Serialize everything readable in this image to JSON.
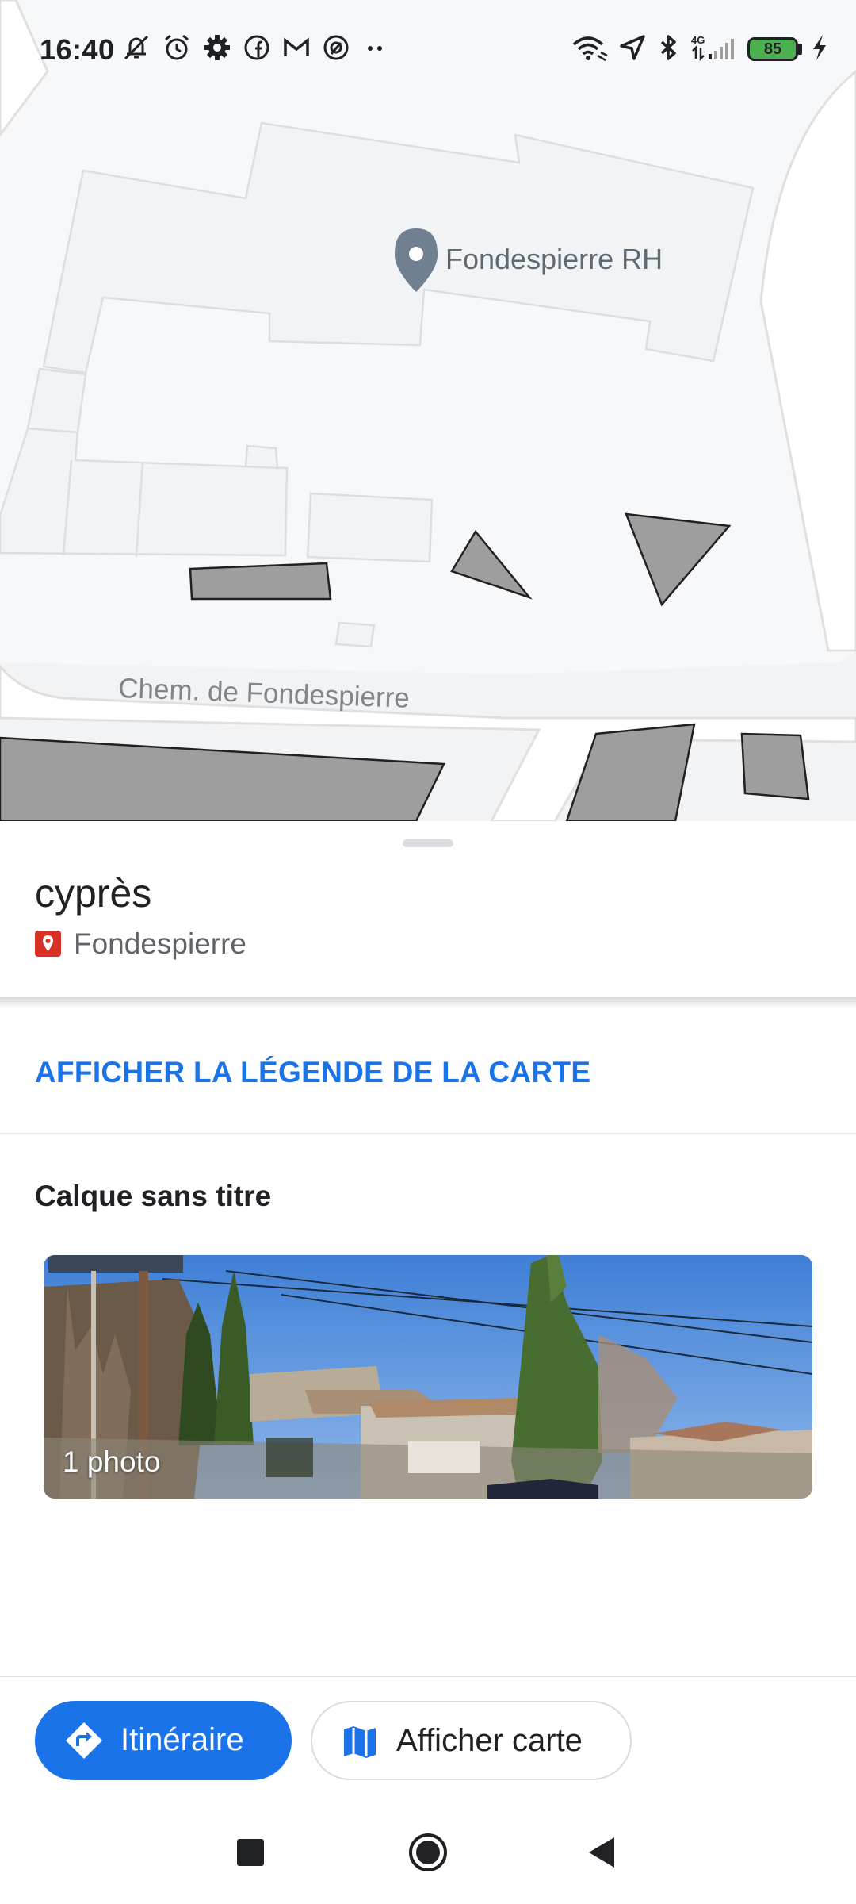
{
  "status_bar": {
    "time": "16:40",
    "battery_level": "85",
    "network": "4G",
    "left_icons": [
      "bell-off-icon",
      "alarm-icon",
      "gear-icon",
      "facebook-icon",
      "gmail-icon",
      "app-notification-icon",
      "more-dots-icon"
    ],
    "right_icons": [
      "wifi-icon",
      "location-arrow-icon",
      "bluetooth-icon",
      "signal-icon",
      "battery-icon",
      "charging-icon"
    ]
  },
  "map": {
    "place_label": "Fondespierre RH",
    "road_label": "Chem. de Fondespierre"
  },
  "sheet": {
    "title": "cyprès",
    "subtitle": "Fondespierre",
    "legend_link": "AFFICHER LA LÉGENDE DE LA CARTE",
    "layer_title": "Calque sans titre",
    "photo_count": "1 photo"
  },
  "actions": {
    "route_label": "Itinéraire",
    "map_label": "Afficher carte"
  },
  "colors": {
    "accent": "#1a73e8",
    "pin_red": "#d93025",
    "map_background": "#f1f3f4",
    "drawn_shape": "#9e9e9e"
  }
}
